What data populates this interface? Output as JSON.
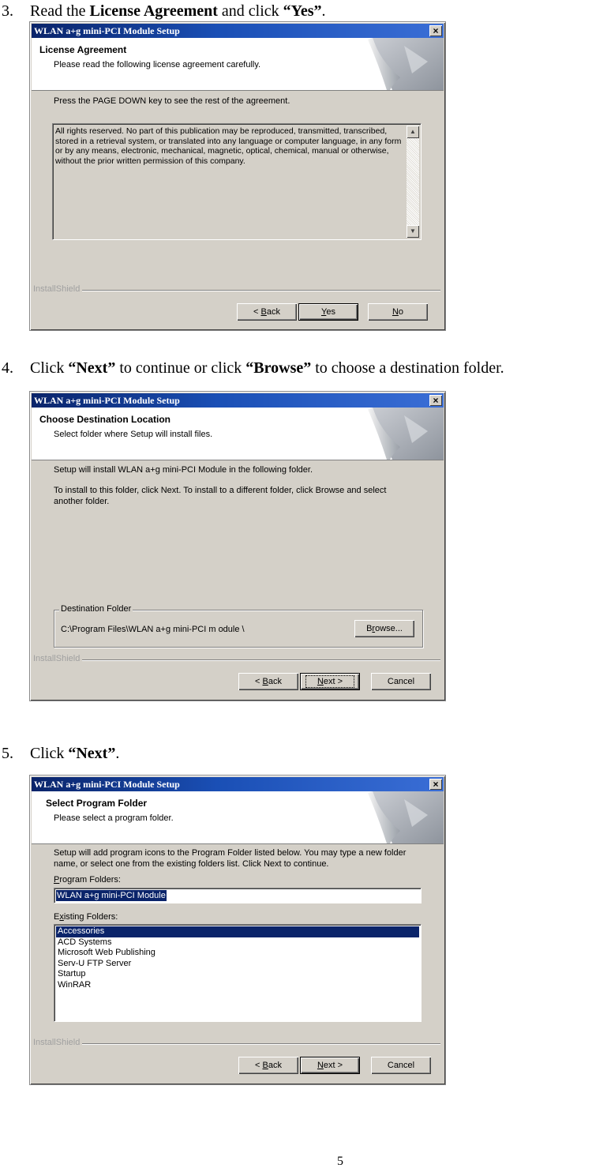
{
  "steps": [
    {
      "number": "3.",
      "text_parts": [
        {
          "text": "Read the ",
          "bold": false
        },
        {
          "text": "License Agreement",
          "bold": true
        },
        {
          "text": " and click ",
          "bold": false
        },
        {
          "text": "“Yes”",
          "bold": true
        },
        {
          "text": ".",
          "bold": false
        }
      ],
      "dialog": {
        "title": "WLAN a+g mini-PCI Module Setup",
        "close_icon": "close-icon",
        "header_title": "License Agreement",
        "header_subtitle": "Please read the following license agreement carefully.",
        "instruction": "Press the PAGE DOWN key to see the rest of the agreement.",
        "license_text": "All rights reserved. No part of this publication may be reproduced, transmitted, transcribed, stored in a retrieval system, or translated into any language or computer language, in any form or by any means, electronic, mechanical, magnetic, optical, chemical, manual or otherwise, without the prior written permission of this company.",
        "brand": "InstallShield",
        "buttons": {
          "back": {
            "prefix": "< ",
            "mnemonic": "B",
            "rest": "ack"
          },
          "yes": {
            "prefix": "",
            "mnemonic": "Y",
            "rest": "es"
          },
          "no": {
            "prefix": "",
            "mnemonic": "N",
            "rest": "o"
          }
        }
      }
    },
    {
      "number": "4.",
      "text_parts": [
        {
          "text": "Click ",
          "bold": false
        },
        {
          "text": "“Next”",
          "bold": true
        },
        {
          "text": " to continue or click ",
          "bold": false
        },
        {
          "text": "“Browse”",
          "bold": true
        },
        {
          "text": " to choose a destination folder.",
          "bold": false
        }
      ],
      "dialog": {
        "title": "WLAN a+g mini-PCI Module Setup",
        "header_title": "Choose Destination Location",
        "header_subtitle": "Select folder where Setup will install files.",
        "line1": "Setup will install WLAN a+g  mini-PCI Module in the following folder.",
        "line2": "To install to this folder, click Next. To install to a different folder, click Browse and select another folder.",
        "group_label": "Destination Folder",
        "destination_path": "C:\\Program Files\\WLAN a+g mini-PCI m odule \\",
        "brand": "InstallShield",
        "buttons": {
          "browse": {
            "prefix": "B",
            "mnemonic": "r",
            "rest": "owse..."
          },
          "back": {
            "prefix": "< ",
            "mnemonic": "B",
            "rest": "ack"
          },
          "next": {
            "prefix": "",
            "mnemonic": "N",
            "rest": "ext >"
          },
          "cancel": {
            "label": "Cancel"
          }
        }
      }
    },
    {
      "number": "5.",
      "text_parts": [
        {
          "text": "Click ",
          "bold": false
        },
        {
          "text": "“Next”",
          "bold": true
        },
        {
          "text": ".",
          "bold": false
        }
      ],
      "dialog": {
        "title": "WLAN a+g mini-PCI Module Setup",
        "header_title": "Select Program Folder",
        "header_subtitle": "Please select a program folder.",
        "description": "Setup will add program icons to the Program Folder listed below.  You may type a new folder name, or select one from the existing folders list.  Click Next to continue.",
        "program_folders_label": {
          "mnemonic": "P",
          "rest": "rogram Folders:"
        },
        "program_folder_value": "WLAN a+g mini-PCI Module",
        "existing_folders_label": {
          "prefix": "E",
          "mnemonic": "x",
          "rest": "isting Folders:"
        },
        "existing_folders": [
          {
            "label": "Accessories",
            "selected": true
          },
          {
            "label": "ACD Systems",
            "selected": false
          },
          {
            "label": "Microsoft Web Publishing",
            "selected": false
          },
          {
            "label": "Serv-U FTP Server",
            "selected": false
          },
          {
            "label": "Startup",
            "selected": false
          },
          {
            "label": "WinRAR",
            "selected": false
          }
        ],
        "brand": "InstallShield",
        "buttons": {
          "back": {
            "prefix": "< ",
            "mnemonic": "B",
            "rest": "ack"
          },
          "next": {
            "prefix": "",
            "mnemonic": "N",
            "rest": "ext >"
          },
          "cancel": {
            "label": "Cancel"
          }
        }
      }
    }
  ],
  "page_number": "5",
  "colors": {
    "titlebar_start": "#0a246a",
    "titlebar_end": "#3a6ed6",
    "dialog_face": "#d4d0c8",
    "selection": "#0a246a"
  }
}
